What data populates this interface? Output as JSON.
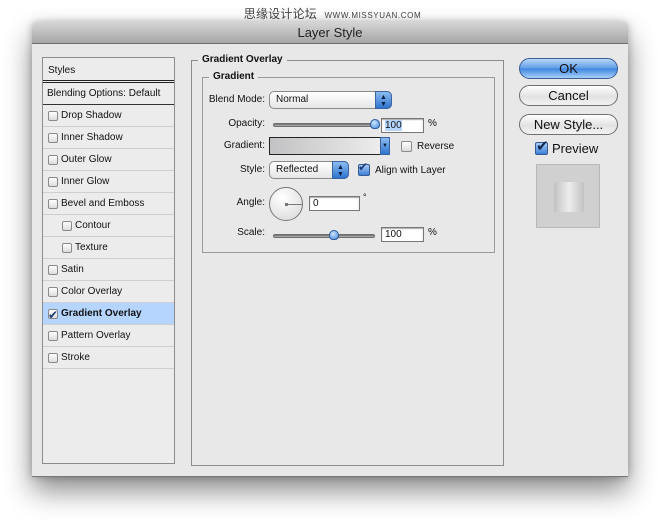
{
  "watermark": {
    "text": "思缘设计论坛",
    "url": "WWW.MISSYUAN.COM"
  },
  "window": {
    "title": "Layer Style"
  },
  "sidebar": {
    "header": "Styles",
    "blending_options": "Blending Options: Default",
    "items": [
      {
        "label": "Drop Shadow",
        "checked": false,
        "sub": false
      },
      {
        "label": "Inner Shadow",
        "checked": false,
        "sub": false
      },
      {
        "label": "Outer Glow",
        "checked": false,
        "sub": false
      },
      {
        "label": "Inner Glow",
        "checked": false,
        "sub": false
      },
      {
        "label": "Bevel and Emboss",
        "checked": false,
        "sub": false
      },
      {
        "label": "Contour",
        "checked": false,
        "sub": true
      },
      {
        "label": "Texture",
        "checked": false,
        "sub": true
      },
      {
        "label": "Satin",
        "checked": false,
        "sub": false
      },
      {
        "label": "Color Overlay",
        "checked": false,
        "sub": false
      },
      {
        "label": "Gradient Overlay",
        "checked": true,
        "sub": false,
        "selected": true
      },
      {
        "label": "Pattern Overlay",
        "checked": false,
        "sub": false
      },
      {
        "label": "Stroke",
        "checked": false,
        "sub": false
      }
    ]
  },
  "panel": {
    "title": "Gradient Overlay",
    "group_title": "Gradient",
    "blend_mode": {
      "label": "Blend Mode:",
      "value": "Normal"
    },
    "opacity": {
      "label": "Opacity:",
      "value": "100",
      "unit": "%",
      "level": 1.0
    },
    "gradient": {
      "label": "Gradient:",
      "colors": [
        "#c2c2c4",
        "#f0f0f0"
      ]
    },
    "reverse": {
      "label": "Reverse",
      "checked": false
    },
    "style": {
      "label": "Style:",
      "value": "Reflected"
    },
    "align_with_layer": {
      "label": "Align with Layer",
      "checked": true
    },
    "angle": {
      "label": "Angle:",
      "value": "0",
      "unit": "°"
    },
    "scale": {
      "label": "Scale:",
      "value": "100",
      "unit": "%",
      "level": 0.6
    }
  },
  "buttons": {
    "ok": "OK",
    "cancel": "Cancel",
    "new_style": "New Style..."
  },
  "preview": {
    "label": "Preview",
    "checked": true
  },
  "colors": {
    "selection": "#b5d5ff",
    "accent": "#3e86e0",
    "window_bg": "#e8e8e8"
  }
}
